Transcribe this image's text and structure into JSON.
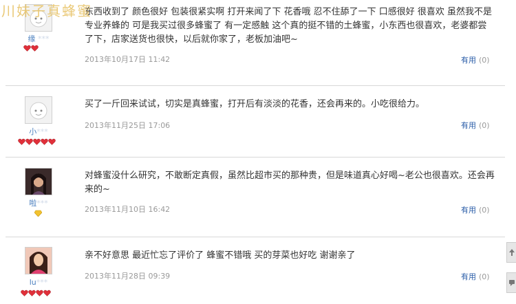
{
  "watermark": "川妹子真蜂蜜",
  "reviews": [
    {
      "username": "缘 ",
      "username_masked": "***",
      "content": "东西收到了 颜色很好 包装很紧实啊 打开来闻了下 花香哦 忍不住舔了一下 口感很好 很喜欢 虽然我不是专业养蜂的 可是我买过很多蜂蜜了 有一定感触 这个真的挺不错的土蜂蜜，小东西也很喜欢，老婆都尝了下，店家送货也很快，以后就你家了，老板加油吧~",
      "date": "2013年10月17日 11:42",
      "useful_label": "有用",
      "useful_count": "(0)",
      "rank_icon": "red-heart-icon",
      "rank_count": 2,
      "avatar": "default-avatar"
    },
    {
      "username": "小",
      "username_masked": "***",
      "content": "买了一斤回来试试，切实是真蜂蜜，打开后有淡淡的花香，还会再来的。小吃很给力。",
      "date": "2013年11月25日 17:06",
      "useful_label": "有用",
      "useful_count": "(0)",
      "rank_icon": "red-heart-icon",
      "rank_count": 5,
      "avatar": "default-avatar"
    },
    {
      "username": "啦",
      "username_masked": "***",
      "content": "对蜂蜜没什么研究，不敢断定真假，虽然比超市买的那种贵，但是味道真心好喝~老公也很喜欢。还会再来的~",
      "date": "2013年11月10日 16:42",
      "useful_label": "有用",
      "useful_count": "(0)",
      "rank_icon": "yellow-diamond-icon",
      "rank_count": 1,
      "avatar": "photo-avatar"
    },
    {
      "username": "lu",
      "username_masked": "***",
      "content": "亲不好意思 最近忙忘了评价了 蜂蜜不错哦 买的芽菜也好吃 谢谢亲了",
      "date": "2013年11月28日 09:39",
      "useful_label": "有用",
      "useful_count": "(0)",
      "rank_icon": "red-heart-icon",
      "rank_count": 4,
      "avatar": "photo-avatar"
    }
  ],
  "side_tools": [
    {
      "icon": "back-to-top-icon"
    },
    {
      "icon": "feedback-icon"
    }
  ],
  "colors": {
    "link": "#2a5da8",
    "username": "#4a7fbf",
    "date": "#999999",
    "heart": "#e0303a",
    "diamond": "#f2c230"
  }
}
